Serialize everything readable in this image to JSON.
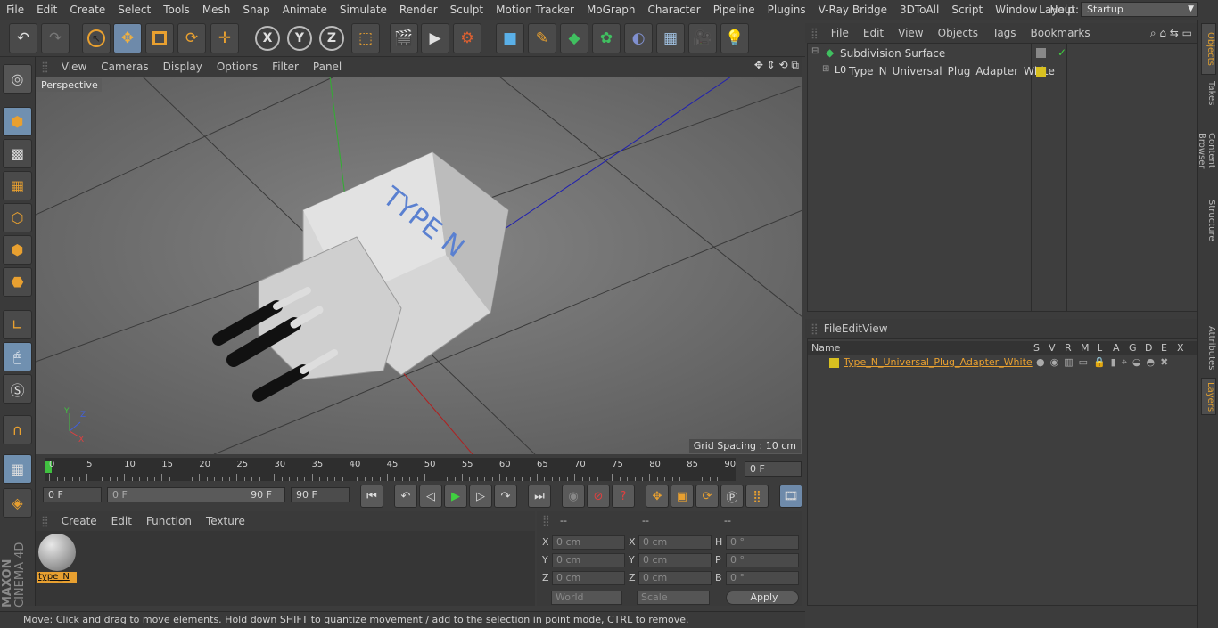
{
  "menubar": {
    "items": [
      "File",
      "Edit",
      "Create",
      "Select",
      "Tools",
      "Mesh",
      "Snap",
      "Animate",
      "Simulate",
      "Render",
      "Sculpt",
      "Motion Tracker",
      "MoGraph",
      "Character",
      "Pipeline",
      "Plugins",
      "V-Ray Bridge",
      "3DToAll",
      "Script",
      "Window",
      "Help"
    ],
    "layout_label": "Layout:",
    "layout_value": "Startup"
  },
  "viewport": {
    "menu": [
      "View",
      "Cameras",
      "Display",
      "Options",
      "Filter",
      "Panel"
    ],
    "label": "Perspective",
    "grid_spacing": "Grid Spacing : 10 cm",
    "plug_text": "TYPE N"
  },
  "timeline": {
    "ticks": [
      "0",
      "5",
      "10",
      "15",
      "20",
      "25",
      "30",
      "35",
      "40",
      "45",
      "50",
      "55",
      "60",
      "65",
      "70",
      "75",
      "80",
      "85",
      "90"
    ],
    "current_frame": "0 F"
  },
  "transport": {
    "start_field": "0 F",
    "range_start": "0 F",
    "range_end": "90 F",
    "end_field": "90 F"
  },
  "material_manager": {
    "menu": [
      "Create",
      "Edit",
      "Function",
      "Texture"
    ],
    "material_label": "type_N"
  },
  "coordinates": {
    "headers": [
      "--",
      "--",
      "--"
    ],
    "rows": [
      {
        "a": "X",
        "av": "0 cm",
        "b": "X",
        "bv": "0 cm",
        "c": "H",
        "cv": "0 °"
      },
      {
        "a": "Y",
        "av": "0 cm",
        "b": "Y",
        "bv": "0 cm",
        "c": "P",
        "cv": "0 °"
      },
      {
        "a": "Z",
        "av": "0 cm",
        "b": "Z",
        "bv": "0 cm",
        "c": "B",
        "cv": "0 °"
      }
    ],
    "mode": "World",
    "size_mode": "Scale",
    "apply": "Apply"
  },
  "object_manager": {
    "menu": [
      "File",
      "Edit",
      "View",
      "Objects",
      "Tags",
      "Bookmarks"
    ],
    "objects": [
      "Subdivision Surface",
      "Type_N_Universal_Plug_Adapter_White"
    ]
  },
  "layer_manager": {
    "menu": [
      "File",
      "Edit",
      "View"
    ],
    "columns": [
      "Name",
      "S",
      "V",
      "R",
      "M",
      "L",
      "A",
      "G",
      "D",
      "E",
      "X"
    ],
    "layer_name": "Type_N_Universal_Plug_Adapter_White"
  },
  "side_tabs": [
    "Objects",
    "Takes",
    "Content Browser",
    "Structure",
    "Attributes",
    "Layers"
  ],
  "brand": {
    "maxon": "MAXON",
    "cinema": "CINEMA 4D"
  },
  "status": "Move: Click and drag to move elements. Hold down SHIFT to quantize movement / add to the selection in point mode, CTRL to remove.",
  "colors": {
    "accent": "#e8a030",
    "selection": "#6e8aaa",
    "layer_color": "#d8c020"
  },
  "icons": [
    "undo-icon",
    "redo-icon",
    "select-icon",
    "move-icon",
    "scale-icon",
    "rotate-icon",
    "transform-icon",
    "x-axis-icon",
    "y-axis-icon",
    "z-axis-icon",
    "coordinate-system-icon",
    "render-view-icon",
    "render-picture-viewer-icon",
    "render-settings-icon",
    "cube-icon",
    "pen-icon",
    "subdivision-icon",
    "mograph-icon",
    "deformer-icon",
    "floor-icon",
    "camera-icon",
    "light-icon"
  ]
}
